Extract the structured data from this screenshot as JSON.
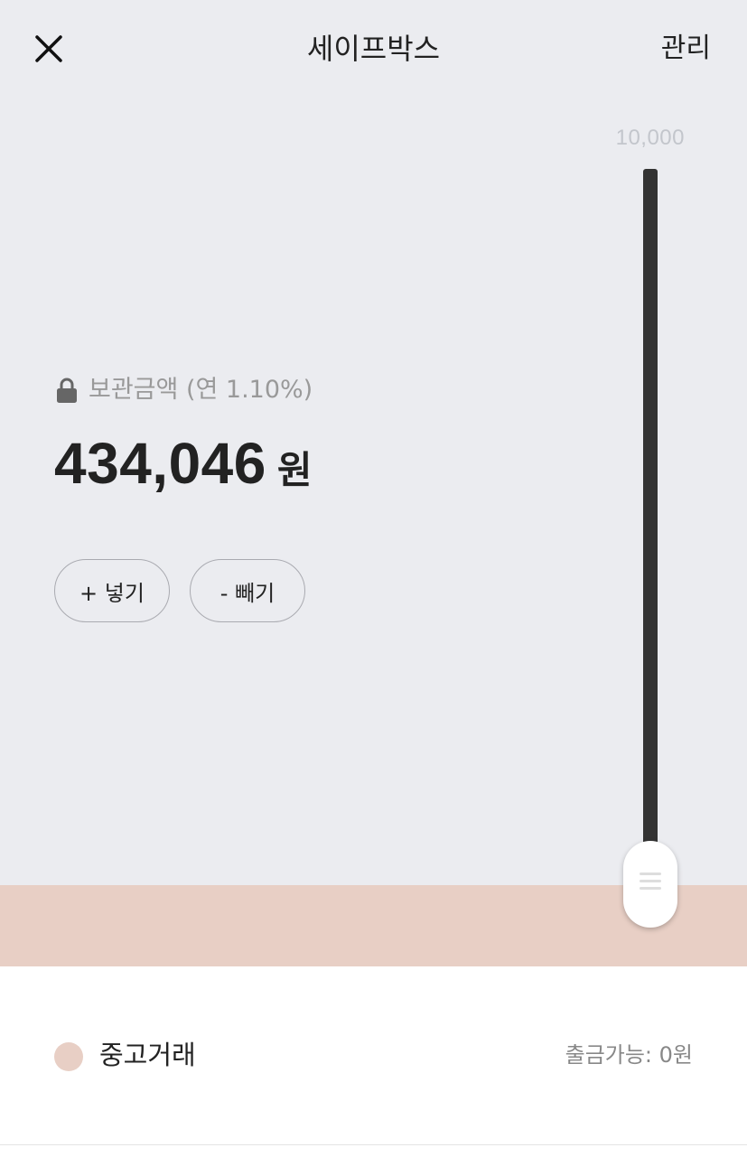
{
  "header": {
    "title": "세이프박스",
    "manage_label": "관리",
    "close_icon": "close-icon"
  },
  "scale": {
    "max_label": "10,000"
  },
  "balance": {
    "label": "보관금액 (연 1.10%)",
    "amount": "434,046",
    "unit": "원",
    "lock_icon": "lock-icon"
  },
  "actions": {
    "deposit_label": "+ 넣기",
    "withdraw_label": "- 빼기"
  },
  "safebox": {
    "name": "중고거래",
    "withdrawable": "출금가능: 0원",
    "color": "#e8cfc5"
  },
  "colors": {
    "background": "#ebecf0",
    "track": "#333333",
    "fill": "#e8cfc5"
  }
}
